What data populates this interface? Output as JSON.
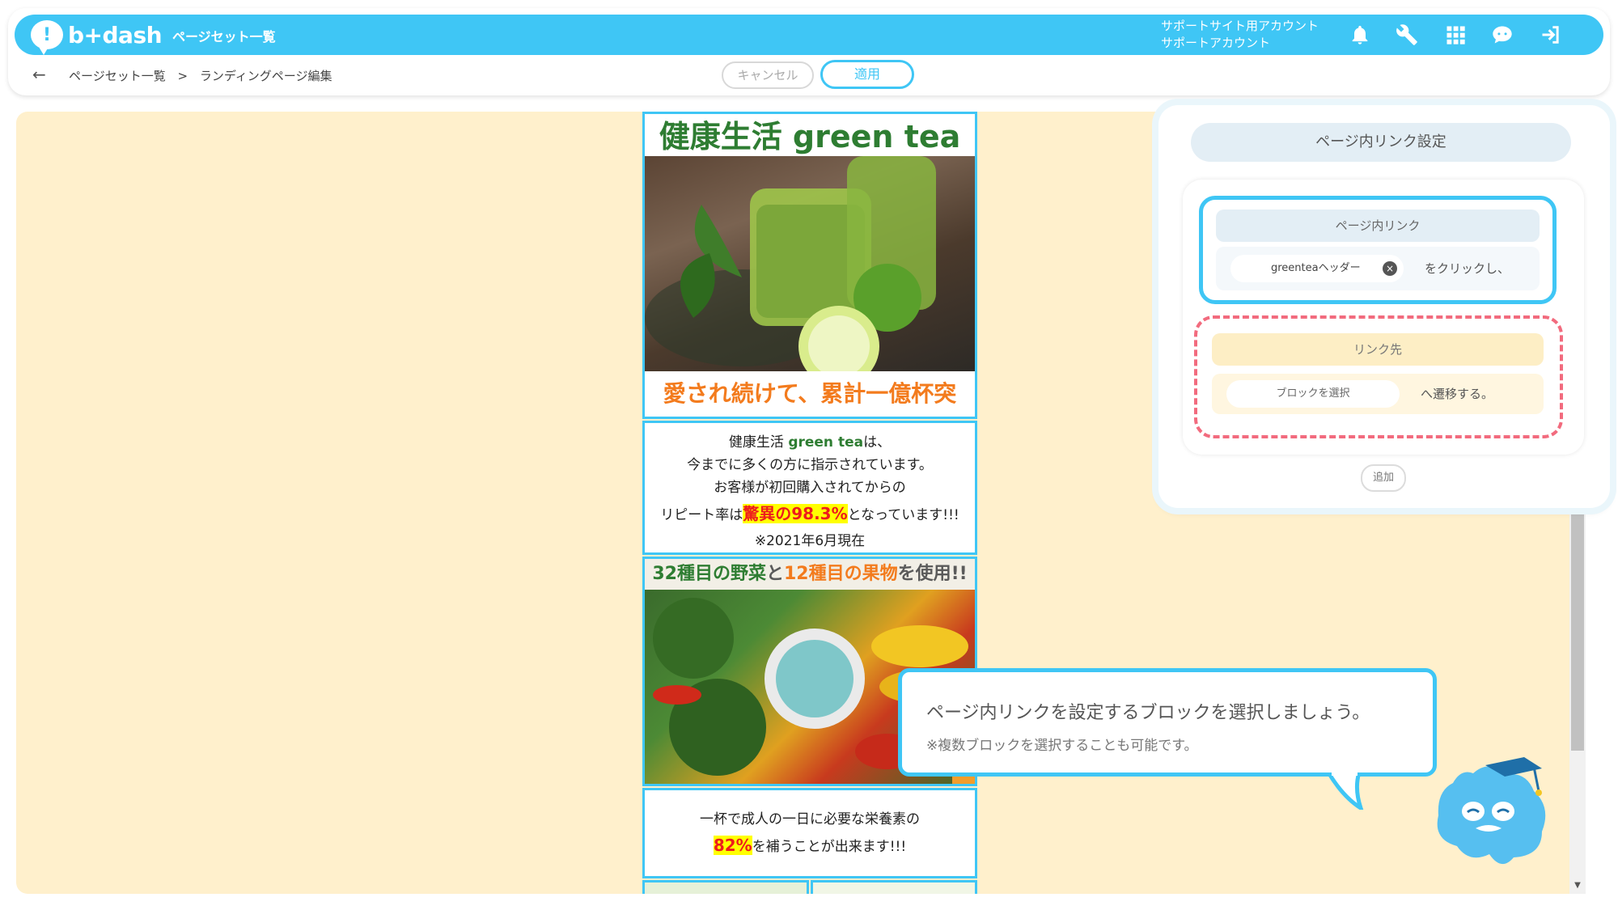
{
  "header": {
    "logo_text": "b+dash",
    "title": "ページセット一覧",
    "account_line1": "サポートサイト用アカウント",
    "account_line2": "サポートアカウント",
    "icons": [
      "bell-icon",
      "wrench-icon",
      "grid-icon",
      "chat-icon",
      "logout-icon"
    ]
  },
  "subbar": {
    "breadcrumb_root": "ページセット一覧",
    "breadcrumb_sep": ">",
    "breadcrumb_current": "ランディングページ編集",
    "cancel_label": "キャンセル",
    "apply_label": "適用"
  },
  "landing": {
    "hero_title": "健康生活 green tea",
    "hero_cta": "愛され続けて、累計一億杯突破!!",
    "intro_line1_a": "健康生活 ",
    "intro_line1_b": "green tea",
    "intro_line1_c": "は、",
    "intro_line2": "今までに多くの方に指示されています。",
    "intro_line3": "お客様が初回購入されてからの",
    "intro_line4_a": "リピート率は",
    "intro_line4_b": "驚異の98.3%",
    "intro_line4_c": "となっています!!!",
    "intro_line5": "※2021年6月現在",
    "veg_title_a": "32種目の野菜",
    "veg_title_b": "と",
    "veg_title_c": "12種目の果物",
    "veg_title_d": "を使用!!",
    "nutri_line1": "一杯で成人の一日に必要な栄養素の",
    "nutri_line2_a": "82%",
    "nutri_line2_b": "を補うことが出来ます!!!"
  },
  "panel": {
    "title": "ページ内リンク設定",
    "link_header": "ページ内リンク",
    "link_chip": "greenteaヘッダー",
    "link_after": "をクリックし、",
    "dest_header": "リンク先",
    "dest_chip": "ブロックを選択",
    "dest_after": "へ遷移する。",
    "add_label": "追加"
  },
  "tooltip": {
    "main": "ページ内リンクを設定するブロックを選択しましょう。",
    "sub": "※複数ブロックを選択することも可能です。"
  },
  "colors": {
    "accent": "#3fc6f5",
    "canvas_bg": "#fff0cc",
    "dest_border": "#f26b7e",
    "highlight": "#ffff00",
    "hero_title": "#2e7d32",
    "hero_cta": "#f37b1d"
  }
}
